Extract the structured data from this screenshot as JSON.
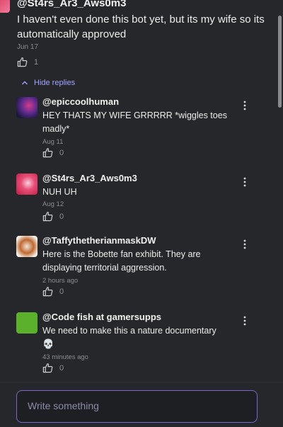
{
  "top_comment": {
    "author": "@St4rs_Ar3_Aws0m3",
    "text": "I haven't even done this bot yet, but its my wife so its automatically approved",
    "date": "Jun 17",
    "likes": "1"
  },
  "hide_replies_label": "Hide replies",
  "replies": [
    {
      "author": "@epiccoolhuman",
      "text": "HEY THATS MY WIFE GRRRRR *wiggles toes madly*",
      "date": "Aug 11",
      "likes": "0"
    },
    {
      "author": "@St4rs_Ar3_Aws0m3",
      "text": "NUH UH",
      "date": "Aug 12",
      "likes": "0"
    },
    {
      "author": "@TaffythetherianmaskDW",
      "text": "Here is the Bobette fan exhibit. They are displaying territorial aggression.",
      "date": "2 hours ago",
      "likes": "0"
    },
    {
      "author": "@Code fish at gamersupps",
      "text": "We need to make this a nature documentary",
      "emoji": "💀",
      "date": "43 minutes ago",
      "likes": "0"
    }
  ],
  "composer": {
    "placeholder": "Write something"
  },
  "colors": {
    "background": "#26272b",
    "accent": "#a2a3ff",
    "composer_border": "#7b66c9",
    "muted": "#8c8d91"
  }
}
